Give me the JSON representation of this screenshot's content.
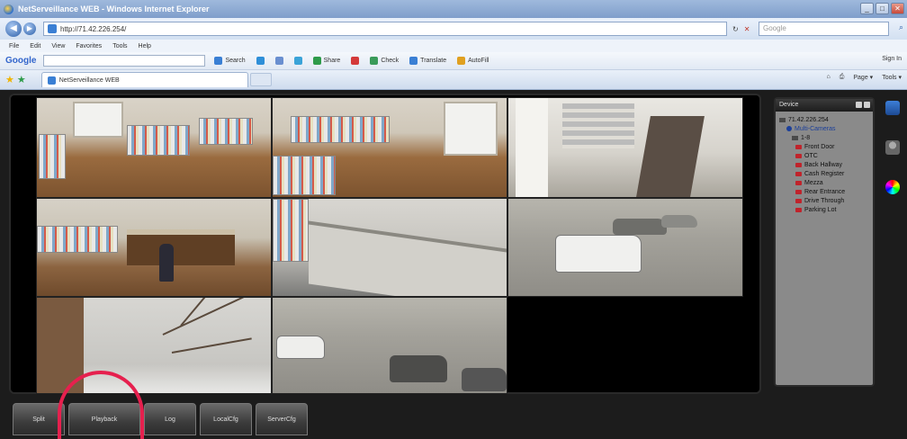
{
  "window": {
    "title": "NetServeillance WEB - Windows Internet Explorer",
    "minimize": "_",
    "maximize": "□",
    "close": "✕"
  },
  "address": {
    "url": "http://71.42.226.254/",
    "refresh": "↻",
    "stop": "✕",
    "search_placeholder": "Google",
    "go": "⌕"
  },
  "menu": [
    "File",
    "Edit",
    "View",
    "Favorites",
    "Tools",
    "Help"
  ],
  "google_toolbar": {
    "logo": "Google",
    "tools": [
      {
        "label": "Search",
        "color": "#3a7fd4"
      },
      {
        "label": "",
        "color": "#2f8fd8"
      },
      {
        "label": "",
        "color": "#6a8fd0"
      },
      {
        "label": "",
        "color": "#3aa3d8"
      },
      {
        "label": "Share",
        "color": "#2e9b4a"
      },
      {
        "label": "",
        "color": "#d43a3a"
      },
      {
        "label": "Check",
        "color": "#3a9b5a"
      },
      {
        "label": "Translate",
        "color": "#3a7fd4"
      },
      {
        "label": "AutoFill",
        "color": "#e0a020"
      }
    ],
    "sign_in": "Sign In"
  },
  "tabs": {
    "active": "NetServeillance WEB",
    "commands": [
      "Page ▾",
      "Tools ▾"
    ]
  },
  "device_panel": {
    "header": "Device",
    "root": "71.42.226.254",
    "group": "Multi-Cameras",
    "subgroup": "1-8",
    "cameras": [
      "Front Door",
      "OTC",
      "Back Hallway",
      "Cash Register",
      "Mezza",
      "Rear Entrance",
      "Drive Through",
      "Parking Lot"
    ]
  },
  "toolbar": {
    "buttons": [
      "Split",
      "Playback",
      "Log",
      "LocalCfg",
      "ServerCfg"
    ]
  },
  "colors": {
    "highlight": "#e6204e",
    "panel_bg": "#8a8a8a",
    "app_bg": "#1c1c1c"
  }
}
